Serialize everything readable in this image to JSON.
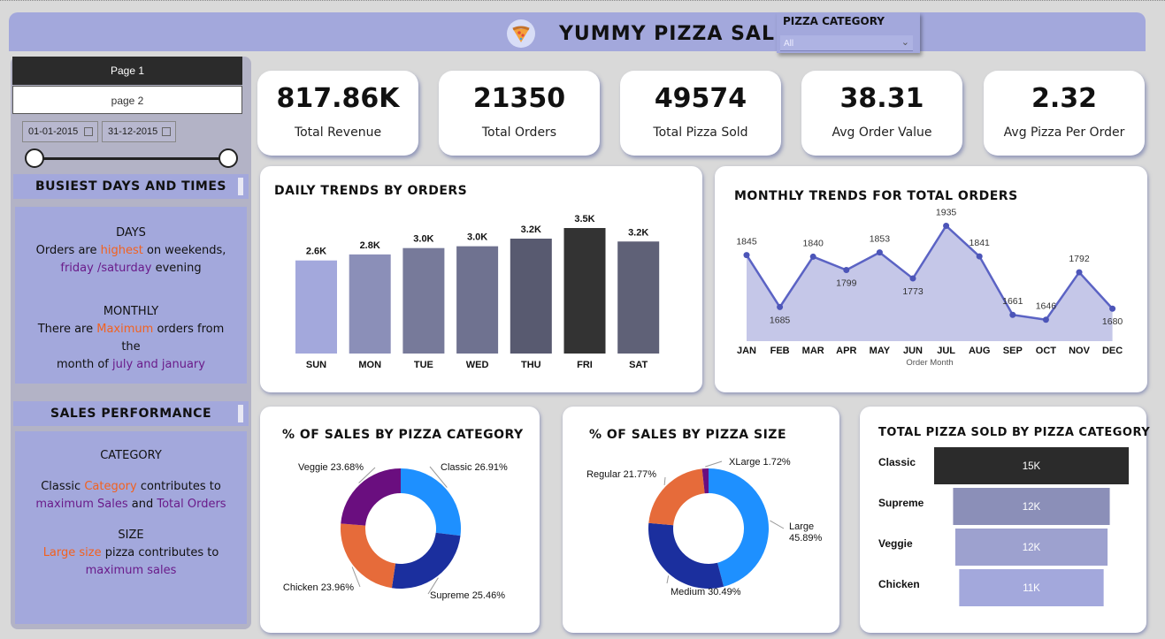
{
  "header": {
    "title": "YUMMY PIZZA SALES",
    "filter": {
      "label": "PIZZA CATEGORY",
      "value": "All"
    }
  },
  "sidebar": {
    "nav": [
      {
        "label": "Page 1",
        "active": true
      },
      {
        "label": "page 2",
        "active": false
      }
    ],
    "date_from": "01-01-2015",
    "date_to": "31-12-2015",
    "busiest_heading": "BUSIEST DAYS AND TIMES",
    "days_heading": "DAYS",
    "days_text": {
      "t1": "Orders are ",
      "t2": "highest",
      "t3": " on weekends,",
      "t4": "friday /saturday",
      "t5": " evening"
    },
    "monthly_heading": "MONTHLY",
    "monthly_text": {
      "t1": "There are ",
      "t2": "Maximum",
      "t3": " orders  from",
      "t4": "the",
      "t5": "month of ",
      "t6": "july and january"
    },
    "sales_heading": "SALES PERFORMANCE",
    "category_heading": "CATEGORY",
    "category_text": {
      "t1": "Classic ",
      "t2": "Category",
      "t3": " contributes to",
      "t4": "maximum Sales",
      "t5": " and ",
      "t6": "Total Orders"
    },
    "size_heading": "SIZE",
    "size_text": {
      "t1": "Large size",
      "t2": " pizza contributes to",
      "t3": "maximum sales"
    }
  },
  "kpis": [
    {
      "value": "817.86K",
      "label": "Total Revenue"
    },
    {
      "value": "21350",
      "label": "Total Orders"
    },
    {
      "value": "49574",
      "label": "Total Pizza Sold"
    },
    {
      "value": "38.31",
      "label": "Avg Order Value"
    },
    {
      "value": "2.32",
      "label": "Avg Pizza Per Order"
    }
  ],
  "colors": {
    "header": "#a3a8dc",
    "accent_orange": "#f2611f",
    "accent_purple": "#6a1b8a",
    "cat_classic": "#1e90ff",
    "cat_supreme": "#1b2f9e",
    "cat_chicken": "#e66b3a",
    "cat_veggie": "#6a0e7f"
  },
  "chart_data": [
    {
      "type": "bar",
      "title": "DAILY TRENDS BY ORDERS",
      "categories": [
        "SUN",
        "MON",
        "TUE",
        "WED",
        "THU",
        "FRI",
        "SAT"
      ],
      "values": [
        2624,
        2794,
        2973,
        3024,
        3239,
        3538,
        3158
      ],
      "labels": [
        "2.6K",
        "2.8K",
        "3.0K",
        "3.0K",
        "3.2K",
        "3.5K",
        "3.2K"
      ],
      "colors": [
        "#a3a8dc",
        "#8b8fb8",
        "#777a9a",
        "#6f7290",
        "#585a70",
        "#333333",
        "#5f6177"
      ],
      "ylim": [
        0,
        3538
      ]
    },
    {
      "type": "area",
      "title": "MONTHLY TRENDS FOR TOTAL ORDERS",
      "xlabel": "Order Month",
      "categories": [
        "JAN",
        "FEB",
        "MAR",
        "APR",
        "MAY",
        "JUN",
        "JUL",
        "AUG",
        "SEP",
        "OCT",
        "NOV",
        "DEC"
      ],
      "values": [
        1845,
        1685,
        1840,
        1799,
        1853,
        1773,
        1935,
        1841,
        1661,
        1646,
        1792,
        1680
      ],
      "ylim": [
        1580,
        1950
      ]
    },
    {
      "type": "pie",
      "title": "% OF SALES BY PIZZA CATEGORY",
      "donut": true,
      "slices": [
        {
          "name": "Classic",
          "value": 26.91,
          "label": "Classic 26.91%",
          "color": "#1e90ff"
        },
        {
          "name": "Supreme",
          "value": 25.46,
          "label": "Supreme 25.46%",
          "color": "#1b2f9e"
        },
        {
          "name": "Chicken",
          "value": 23.96,
          "label": "Chicken 23.96%",
          "color": "#e66b3a"
        },
        {
          "name": "Veggie",
          "value": 23.68,
          "label": "Veggie 23.68%",
          "color": "#6a0e7f"
        }
      ]
    },
    {
      "type": "pie",
      "title": "% OF SALES BY PIZZA SIZE",
      "donut": true,
      "slices": [
        {
          "name": "Large",
          "value": 45.89,
          "label": [
            "Large",
            "45.89%"
          ],
          "color": "#1e90ff"
        },
        {
          "name": "Medium",
          "value": 30.49,
          "label": "Medium 30.49%",
          "color": "#1b2f9e"
        },
        {
          "name": "Regular",
          "value": 21.77,
          "label": "Regular 21.77%",
          "color": "#e66b3a"
        },
        {
          "name": "XLarge",
          "value": 1.72,
          "label": "XLarge 1.72%",
          "color": "#6a0e7f"
        }
      ]
    },
    {
      "type": "bar",
      "orientation": "horizontal",
      "title": "TOTAL PIZZA SOLD BY PIZZA CATEGORY",
      "categories": [
        "Classic",
        "Supreme",
        "Veggie",
        "Chicken"
      ],
      "values": [
        14888,
        11987,
        11649,
        11050
      ],
      "labels": [
        "15K",
        "12K",
        "12K",
        "11K"
      ],
      "colors": [
        "#2b2b2b",
        "#8b8fb8",
        "#9da1cf",
        "#a3a8dc"
      ]
    }
  ]
}
